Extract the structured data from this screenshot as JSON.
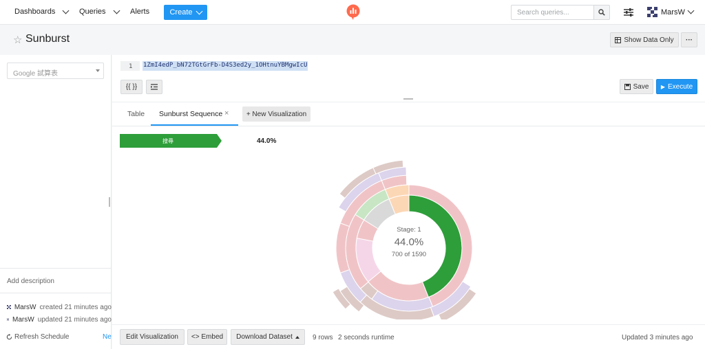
{
  "nav": {
    "dashboards": "Dashboards",
    "queries": "Queries",
    "alerts": "Alerts",
    "create": "Create",
    "search_placeholder": "Search queries...",
    "user": "MarsW",
    "accent": "#2196f3"
  },
  "titlebar": {
    "title": "Sunburst",
    "show_data_only": "Show Data Only",
    "more": "···"
  },
  "left": {
    "data_source": "Google 試算表",
    "add_description": "Add description",
    "activity": [
      {
        "user": "MarsW",
        "text": "created 21 minutes ago"
      },
      {
        "user": "MarsW",
        "text": "updated 21 minutes ago"
      }
    ],
    "refresh_schedule": "Refresh Schedule",
    "never": "Never"
  },
  "editor": {
    "line_number": "1",
    "query": "1ZmI4edP_bN72TGtGrFb-D4S3ed2y_1OHtnuYBMgwIcU",
    "format_label": "{{ }}",
    "save": "Save",
    "execute": "Execute"
  },
  "tabs": {
    "table": "Table",
    "active": "Sunburst Sequence",
    "close": "×",
    "new_viz": "+ New Visualization"
  },
  "viz": {
    "breadcrumb_label": "搜尋",
    "breadcrumb_pct": "44.0%",
    "center_stage": "Stage: 1",
    "center_pct": "44.0%",
    "center_count": "700 of 1590"
  },
  "chart_data": {
    "type": "sunburst",
    "total": 1590,
    "highlighted": {
      "stage": 1,
      "count": 700,
      "percent": 44.0
    },
    "ring1": [
      {
        "value": 0.44,
        "color": "#2e9e3a"
      },
      {
        "value": 0.2,
        "color": "#f0c4c7"
      },
      {
        "value": 0.14,
        "color": "#f5d6e8"
      },
      {
        "value": 0.12,
        "color": "#f0c4c7"
      },
      {
        "value": 0.1,
        "color": "#d9d9d9"
      }
    ],
    "colors": {
      "green": "#2e9e3a",
      "pink": "#f0c4c7",
      "lightpink": "#f5d6e8",
      "lavender": "#dcd3ec",
      "taupe": "#ddcac6",
      "grey": "#d9d9d9",
      "peach": "#fcd7b6",
      "lightgreen": "#c8e6c4"
    }
  },
  "footer": {
    "edit_viz": "Edit Visualization",
    "embed": "<> Embed",
    "download": "Download Dataset",
    "rows": "9 rows",
    "runtime": "2 seconds runtime",
    "updated": "Updated 3 minutes ago"
  }
}
